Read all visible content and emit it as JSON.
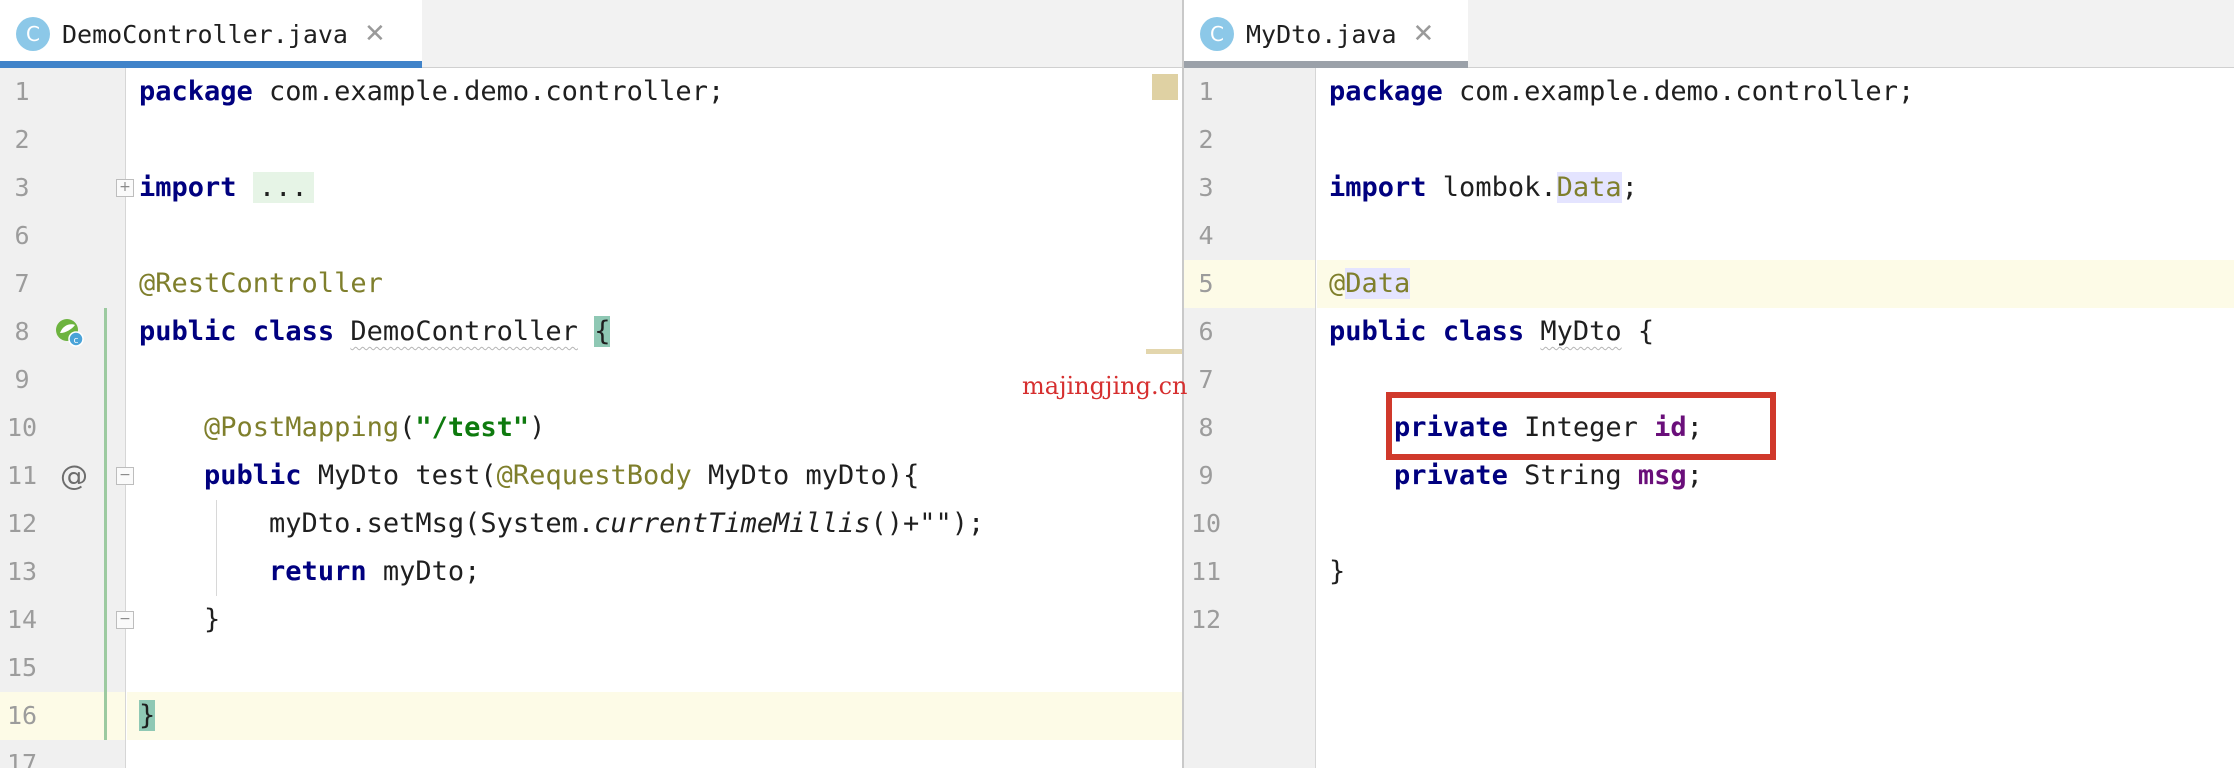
{
  "left": {
    "tab": {
      "icon": "C",
      "title": "DemoController.java",
      "close": "✕"
    },
    "line_numbers": [
      "1",
      "2",
      "3",
      "6",
      "7",
      "8",
      "9",
      "10",
      "11",
      "12",
      "13",
      "14",
      "15",
      "16",
      "17"
    ],
    "lines": {
      "l1": {
        "kw": "package",
        "rest": " com.example.demo.controller;"
      },
      "l3": {
        "kw": "import",
        "fold": "..."
      },
      "l7": {
        "ann": "@RestController"
      },
      "l8": {
        "kw1": "public",
        "kw2": "class",
        "name": "DemoController",
        "brace": "{"
      },
      "l10": {
        "ann": "@PostMapping",
        "open": "(",
        "str": "\"/test\"",
        "close": ")"
      },
      "l11": {
        "kw": "public",
        "type": "MyDto",
        "method": " test(",
        "ann": "@RequestBody",
        "params": " MyDto myDto){"
      },
      "l12": {
        "pre": "myDto.setMsg(System.",
        "italic": "currentTimeMillis",
        "post": "()+\"\");"
      },
      "l13": {
        "kw": "return",
        "rest": " myDto;"
      },
      "l14": {
        "text": "}"
      },
      "l16": {
        "brace": "}"
      }
    },
    "gutter_icons": {
      "run": "spring-bean-icon",
      "override": "@"
    }
  },
  "right": {
    "tab": {
      "icon": "C",
      "title": "MyDto.java",
      "close": "✕"
    },
    "line_numbers": [
      "1",
      "2",
      "3",
      "4",
      "5",
      "6",
      "7",
      "8",
      "9",
      "10",
      "11",
      "12"
    ],
    "lines": {
      "l1": {
        "kw": "package",
        "rest": " com.example.demo.controller;"
      },
      "l3": {
        "kw": "import",
        "pkg": " lombok.",
        "cls": "Data",
        "semi": ";"
      },
      "l5": {
        "at": "@",
        "ann": "Data"
      },
      "l6": {
        "kw1": "public",
        "kw2": "class",
        "name": "MyDto",
        "brace": " {"
      },
      "l8": {
        "kw": "private",
        "type": " Integer ",
        "field": "id",
        "semi": ";"
      },
      "l9": {
        "kw": "private",
        "type": " String ",
        "field": "msg",
        "semi": ";"
      },
      "l11": {
        "text": "}"
      }
    }
  },
  "watermark": "majingjing.cn",
  "colors": {
    "keyword": "#00007f",
    "annotation": "#7f7f2c",
    "string": "#0e7a0e",
    "field": "#6a0f7a",
    "highlight_line": "#fdfbe7",
    "red_box": "#d0392b",
    "tab_active_underline": "#4083c9"
  }
}
